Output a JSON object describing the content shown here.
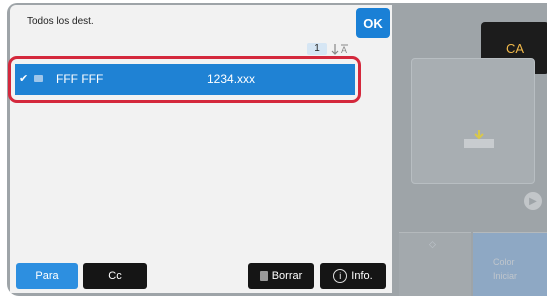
{
  "dialog": {
    "title": "Todos los dest.",
    "ok_label": "OK",
    "counter": "1",
    "sort_icon": "sort-az-icon"
  },
  "destination": {
    "check_icon": "checkmark-icon",
    "type_icon": "email-icon",
    "name": "FFF FFF",
    "address": "1234.xxx"
  },
  "buttons": {
    "para": "Para",
    "cc": "Cc",
    "borrar": "Borrar",
    "info": "Info."
  },
  "background_panel": {
    "ca_label": "CA",
    "preview_label": "",
    "bw_label": "",
    "color_label": "Color",
    "start_label": "Iniciar"
  },
  "colors": {
    "accent": "#1f82d4",
    "highlight": "#d4283c",
    "ca_text": "#f0b84a"
  }
}
